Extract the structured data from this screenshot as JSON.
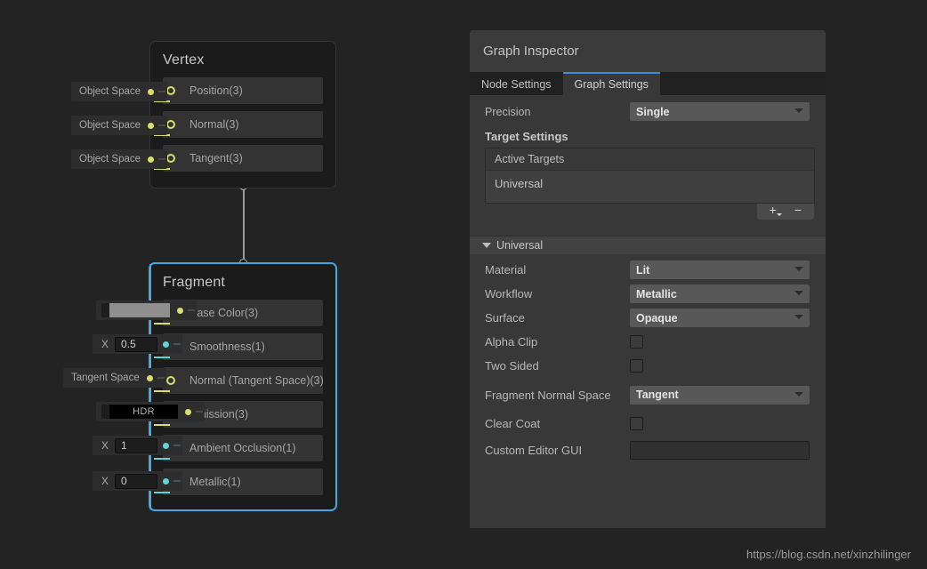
{
  "watermark": "https://blog.csdn.net/xinzhilinger",
  "graph": {
    "vertex_node": {
      "title": "Vertex",
      "ports": [
        {
          "label": "Position(3)",
          "type": "vec3",
          "control": "Object Space"
        },
        {
          "label": "Normal(3)",
          "type": "vec3",
          "control": "Object Space"
        },
        {
          "label": "Tangent(3)",
          "type": "vec3",
          "control": "Object Space"
        }
      ]
    },
    "fragment_node": {
      "title": "Fragment",
      "ports": [
        {
          "label": "Base Color(3)",
          "type": "vec3",
          "control": "swatch"
        },
        {
          "label": "Smoothness(1)",
          "type": "float",
          "control": "number",
          "axis": "X",
          "value": "0.5"
        },
        {
          "label": "Normal (Tangent Space)(3)",
          "type": "vec3",
          "control": "Tangent Space"
        },
        {
          "label": "Emission(3)",
          "type": "vec3",
          "control": "hdr",
          "hdr_label": "HDR"
        },
        {
          "label": "Ambient Occlusion(1)",
          "type": "float",
          "control": "number",
          "axis": "X",
          "value": "1"
        },
        {
          "label": "Metallic(1)",
          "type": "float",
          "control": "number",
          "axis": "X",
          "value": "0"
        }
      ]
    },
    "colors": {
      "vec3_port": "#d9dd70",
      "float_port": "#5fd6d6",
      "selection": "#44a8e0",
      "node_bg": "#1b1b1b",
      "canvas_bg": "#232323"
    }
  },
  "inspector": {
    "title": "Graph Inspector",
    "tabs": [
      {
        "label": "Node Settings",
        "active": false
      },
      {
        "label": "Graph Settings",
        "active": true
      }
    ],
    "precision": {
      "label": "Precision",
      "value": "Single"
    },
    "target_settings": {
      "heading": "Target Settings",
      "list_header": "Active Targets",
      "items": [
        "Universal"
      ],
      "add_button": "+",
      "remove_button": "−"
    },
    "universal_foldout": {
      "label": "Universal",
      "expanded": true,
      "properties": [
        {
          "label": "Material",
          "kind": "dropdown",
          "value": "Lit"
        },
        {
          "label": "Workflow",
          "kind": "dropdown",
          "value": "Metallic"
        },
        {
          "label": "Surface",
          "kind": "dropdown",
          "value": "Opaque"
        },
        {
          "label": "Alpha Clip",
          "kind": "checkbox",
          "checked": false
        },
        {
          "label": "Two Sided",
          "kind": "checkbox",
          "checked": false
        },
        {
          "label": "Fragment Normal Space",
          "kind": "dropdown",
          "value": "Tangent"
        },
        {
          "label": "Clear Coat",
          "kind": "checkbox",
          "checked": false
        },
        {
          "label": "Custom Editor GUI",
          "kind": "textfield",
          "value": ""
        }
      ]
    },
    "accent_color": "#3c8ddc"
  }
}
